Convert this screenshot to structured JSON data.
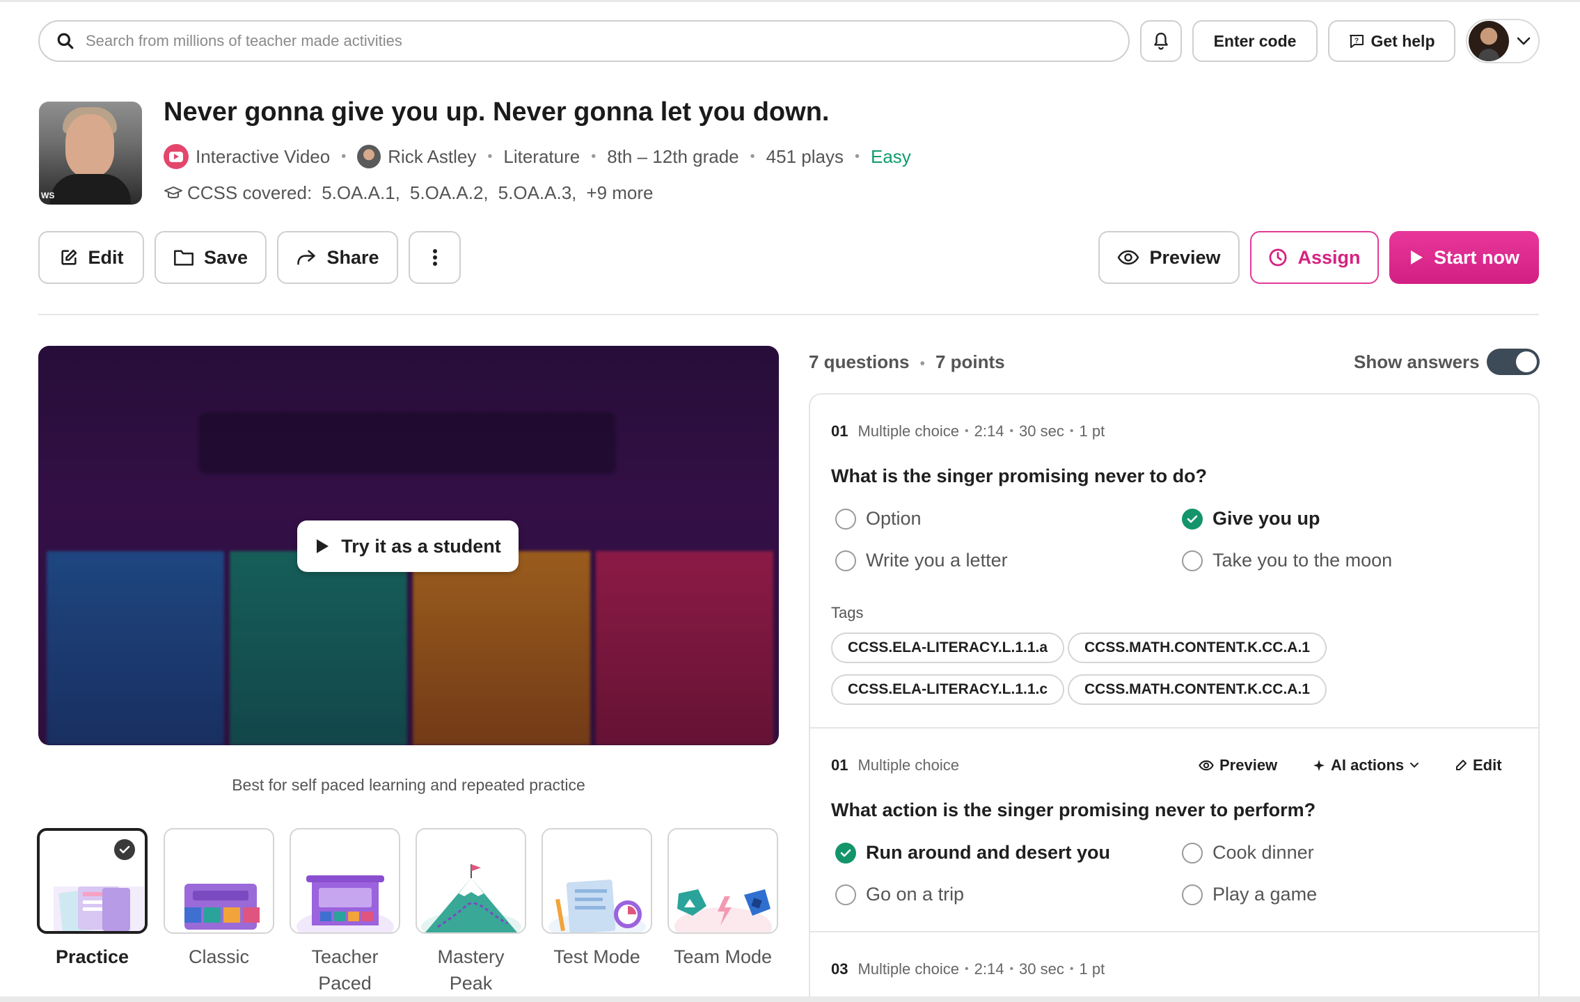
{
  "topbar": {
    "search_placeholder": "Search from millions of teacher made activities",
    "enter_code": "Enter code",
    "get_help": "Get help"
  },
  "activity": {
    "title": "Never gonna give you up. Never gonna let you down.",
    "type": "Interactive Video",
    "author": "Rick Astley",
    "subject": "Literature",
    "grade": "8th – 12th grade",
    "plays": "451 plays",
    "difficulty": "Easy",
    "ccss_label": "CCSS covered:",
    "ccss": [
      "5.OA.A.1,",
      "5.OA.A.2,",
      "5.OA.A.3,",
      "+9 more"
    ],
    "thumb_badge": "WS"
  },
  "actions": {
    "edit": "Edit",
    "save": "Save",
    "share": "Share",
    "preview": "Preview",
    "assign": "Assign",
    "start": "Start now"
  },
  "video": {
    "try_label": "Try it as a student"
  },
  "modes": {
    "caption": "Best for self paced learning and repeated practice",
    "items": [
      {
        "label": "Practice",
        "selected": true
      },
      {
        "label": "Classic",
        "selected": false
      },
      {
        "label": "Teacher Paced",
        "selected": false
      },
      {
        "label": "Mastery Peak",
        "selected": false
      },
      {
        "label": "Test Mode",
        "selected": false
      },
      {
        "label": "Team Mode",
        "selected": false
      }
    ]
  },
  "questions": {
    "count": "7 questions",
    "points": "7 points",
    "show_answers_label": "Show answers",
    "show_answers": true,
    "tags_label": "Tags",
    "items": [
      {
        "num": "01",
        "type": "Multiple choice",
        "time": "2:14",
        "duration": "30 sec",
        "pts": "1 pt",
        "text": "What is the singer promising never to do?",
        "options": [
          {
            "label": "Option",
            "correct": false
          },
          {
            "label": "Give you up",
            "correct": true
          },
          {
            "label": "Write you a letter",
            "correct": false
          },
          {
            "label": "Take you to the moon",
            "correct": false
          }
        ],
        "tags": [
          "CCSS.ELA-LITERACY.L.1.1.a",
          "CCSS.MATH.CONTENT.K.CC.A.1",
          "CCSS.ELA-LITERACY.L.1.1.c",
          "CCSS.MATH.CONTENT.K.CC.A.1"
        ]
      },
      {
        "num": "01",
        "type": "Multiple choice",
        "preview": "Preview",
        "ai_actions": "AI actions",
        "edit": "Edit",
        "text": "What action is the singer promising never to perform?",
        "options": [
          {
            "label": "Run around and desert you",
            "correct": true
          },
          {
            "label": "Cook dinner",
            "correct": false
          },
          {
            "label": "Go on a trip",
            "correct": false
          },
          {
            "label": "Play a game",
            "correct": false
          }
        ]
      },
      {
        "num": "03",
        "type": "Multiple choice",
        "time": "2:14",
        "duration": "30 sec",
        "pts": "1 pt"
      }
    ]
  },
  "colors": {
    "accent": "#d21f83",
    "correct": "#14946b",
    "easy": "#0f9d6e",
    "toggle": "#3d4a57"
  }
}
